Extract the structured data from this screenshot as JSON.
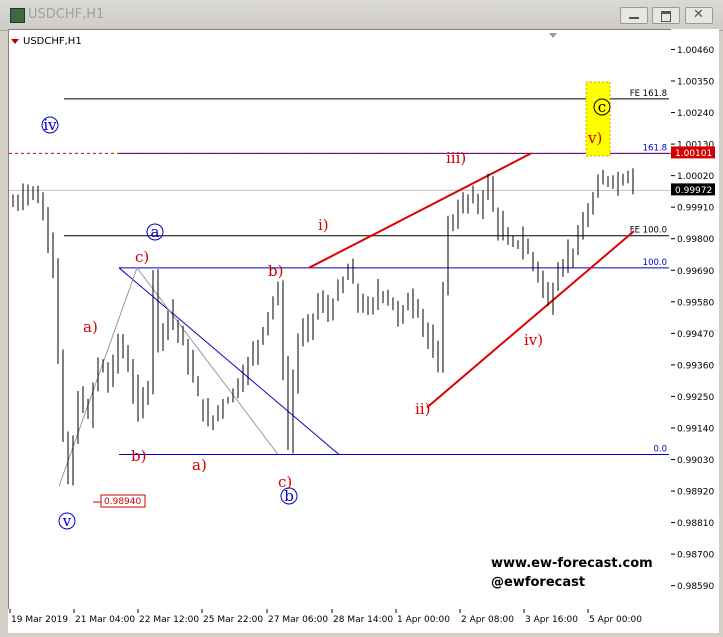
{
  "window": {
    "title": "USDCHF,H1",
    "buttons": [
      "minimize-button",
      "restore-button",
      "close-button"
    ]
  },
  "chart_data": {
    "type": "candlestick",
    "title": "USDCHF,H1",
    "symbol_label": "USDCHF,H1",
    "y_ticks": [
      "1.00460",
      "1.00350",
      "1.00240",
      "1.00130",
      "1.00020",
      "0.99910",
      "0.99800",
      "0.99690",
      "0.99580",
      "0.99470",
      "0.99360",
      "0.99250",
      "0.99140",
      "0.99030",
      "0.98920",
      "0.98810",
      "0.98700",
      "0.98590"
    ],
    "x_ticks": [
      "19 Mar 2019",
      "21 Mar 04:00",
      "22 Mar 12:00",
      "25 Mar 22:00",
      "27 Mar 06:00",
      "28 Mar 14:00",
      "1 Apr 00:00",
      "2 Apr 08:00",
      "3 Apr 16:00",
      "5 Apr 00:00"
    ],
    "ylim": [
      0.9854,
      1.005
    ],
    "current_price": "0.99972",
    "highlight_price": "1.00101",
    "low_price_label": "0.98940",
    "price_path": [
      [
        0,
        0.9992
      ],
      [
        2,
        0.9994
      ],
      [
        4,
        0.9998
      ],
      [
        6,
        0.9994
      ],
      [
        8,
        0.9981
      ],
      [
        9,
        0.9972
      ],
      [
        10,
        0.994
      ],
      [
        11,
        0.991
      ],
      [
        12,
        0.9895
      ],
      [
        13,
        0.991
      ],
      [
        14,
        0.9925
      ],
      [
        16,
        0.9918
      ],
      [
        18,
        0.9938
      ],
      [
        20,
        0.993
      ],
      [
        22,
        0.9945
      ],
      [
        24,
        0.9935
      ],
      [
        26,
        0.992
      ],
      [
        28,
        0.993
      ],
      [
        29,
        0.9968
      ],
      [
        30,
        0.9945
      ],
      [
        32,
        0.9955
      ],
      [
        34,
        0.9948
      ],
      [
        36,
        0.9937
      ],
      [
        38,
        0.9925
      ],
      [
        40,
        0.9915
      ],
      [
        42,
        0.9922
      ],
      [
        44,
        0.9925
      ],
      [
        46,
        0.993
      ],
      [
        48,
        0.9937
      ],
      [
        50,
        0.9945
      ],
      [
        52,
        0.9955
      ],
      [
        54,
        0.9962
      ],
      [
        55,
        0.9935
      ],
      [
        56,
        0.991
      ],
      [
        57,
        0.993
      ],
      [
        58,
        0.9945
      ],
      [
        60,
        0.995
      ],
      [
        62,
        0.9958
      ],
      [
        64,
        0.9955
      ],
      [
        66,
        0.9962
      ],
      [
        68,
        0.997
      ],
      [
        70,
        0.9958
      ],
      [
        72,
        0.9955
      ],
      [
        74,
        0.9962
      ],
      [
        76,
        0.996
      ],
      [
        78,
        0.9952
      ],
      [
        80,
        0.996
      ],
      [
        82,
        0.9955
      ],
      [
        84,
        0.9945
      ],
      [
        86,
        0.9935
      ],
      [
        87,
        0.9965
      ],
      [
        88,
        0.9985
      ],
      [
        90,
        0.999
      ],
      [
        92,
        0.9995
      ],
      [
        94,
        0.9992
      ],
      [
        96,
        1.0
      ],
      [
        97,
        0.999
      ],
      [
        98,
        0.9985
      ],
      [
        100,
        0.9978
      ],
      [
        102,
        0.998
      ],
      [
        104,
        0.9975
      ],
      [
        106,
        0.9968
      ],
      [
        108,
        0.9957
      ],
      [
        110,
        0.997
      ],
      [
        112,
        0.9975
      ],
      [
        114,
        0.998
      ],
      [
        116,
        0.999
      ],
      [
        118,
        0.9999
      ],
      [
        120,
        1.0002
      ],
      [
        122,
        1.0
      ],
      [
        124,
        1.0004
      ],
      [
        125,
        0.9997
      ]
    ],
    "hlines": [
      {
        "label": "FE 161.8",
        "price": 1.00291,
        "color": "#000000"
      },
      {
        "label": "161.8",
        "price": 1.00101,
        "color": "#0000cc"
      },
      {
        "label": "FE 100.0",
        "price": 0.99814,
        "color": "#000000"
      },
      {
        "label": "100.0",
        "price": 0.99702,
        "color": "#0000cc"
      },
      {
        "label": "0.0",
        "price": 0.99051,
        "color": "#0000cc"
      }
    ],
    "wave_labels": [
      "iv",
      "v",
      "a)",
      "b)",
      "c)",
      "a",
      "a)",
      "b)",
      "c)",
      "b",
      "i)",
      "ii)",
      "iii)",
      "iv)",
      "v)",
      "c"
    ],
    "watermark": [
      "www.ew-forecast.com",
      "@ewforecast"
    ]
  }
}
